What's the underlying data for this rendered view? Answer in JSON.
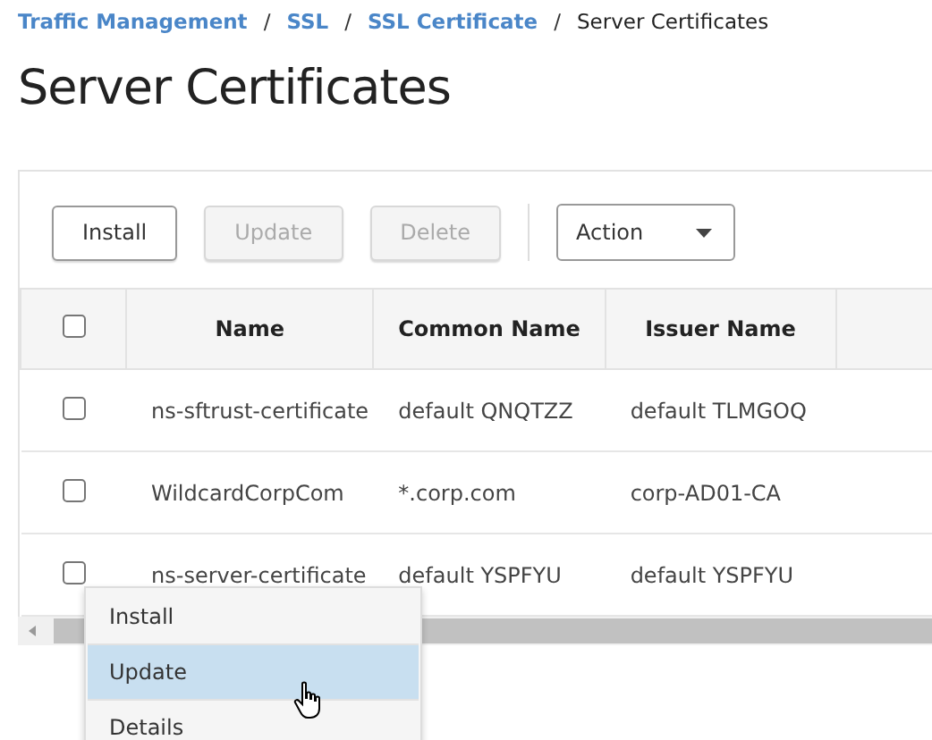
{
  "breadcrumb": [
    {
      "label": "Traffic Management",
      "link": true
    },
    {
      "label": "SSL",
      "link": true
    },
    {
      "label": "SSL Certificate",
      "link": true
    },
    {
      "label": "Server Certificates",
      "link": false
    }
  ],
  "breadcrumb_separator": "/",
  "title": "Server Certificates",
  "toolbar": {
    "buttons": [
      {
        "label": "Install",
        "disabled": false
      },
      {
        "label": "Update",
        "disabled": true
      },
      {
        "label": "Delete",
        "disabled": true
      }
    ],
    "action_dropdown": {
      "label": "Action"
    }
  },
  "table": {
    "select_all_checked": false,
    "columns": [
      "Name",
      "Common Name",
      "Issuer Name"
    ],
    "rows": [
      {
        "checked": false,
        "cells": [
          "ns-sftrust-certificate",
          "default QNQTZZ",
          "default TLMGOQ"
        ]
      },
      {
        "checked": false,
        "cells": [
          "WildcardCorpCom",
          "*.corp.com",
          "corp-AD01-CA"
        ]
      },
      {
        "checked": false,
        "cells": [
          "ns-server-certificate",
          "default YSPFYU",
          "default YSPFYU"
        ]
      }
    ]
  },
  "context_menu": [
    {
      "label": "Install",
      "selected": false
    },
    {
      "label": "Update",
      "selected": true
    },
    {
      "label": "Details",
      "selected": false
    }
  ]
}
